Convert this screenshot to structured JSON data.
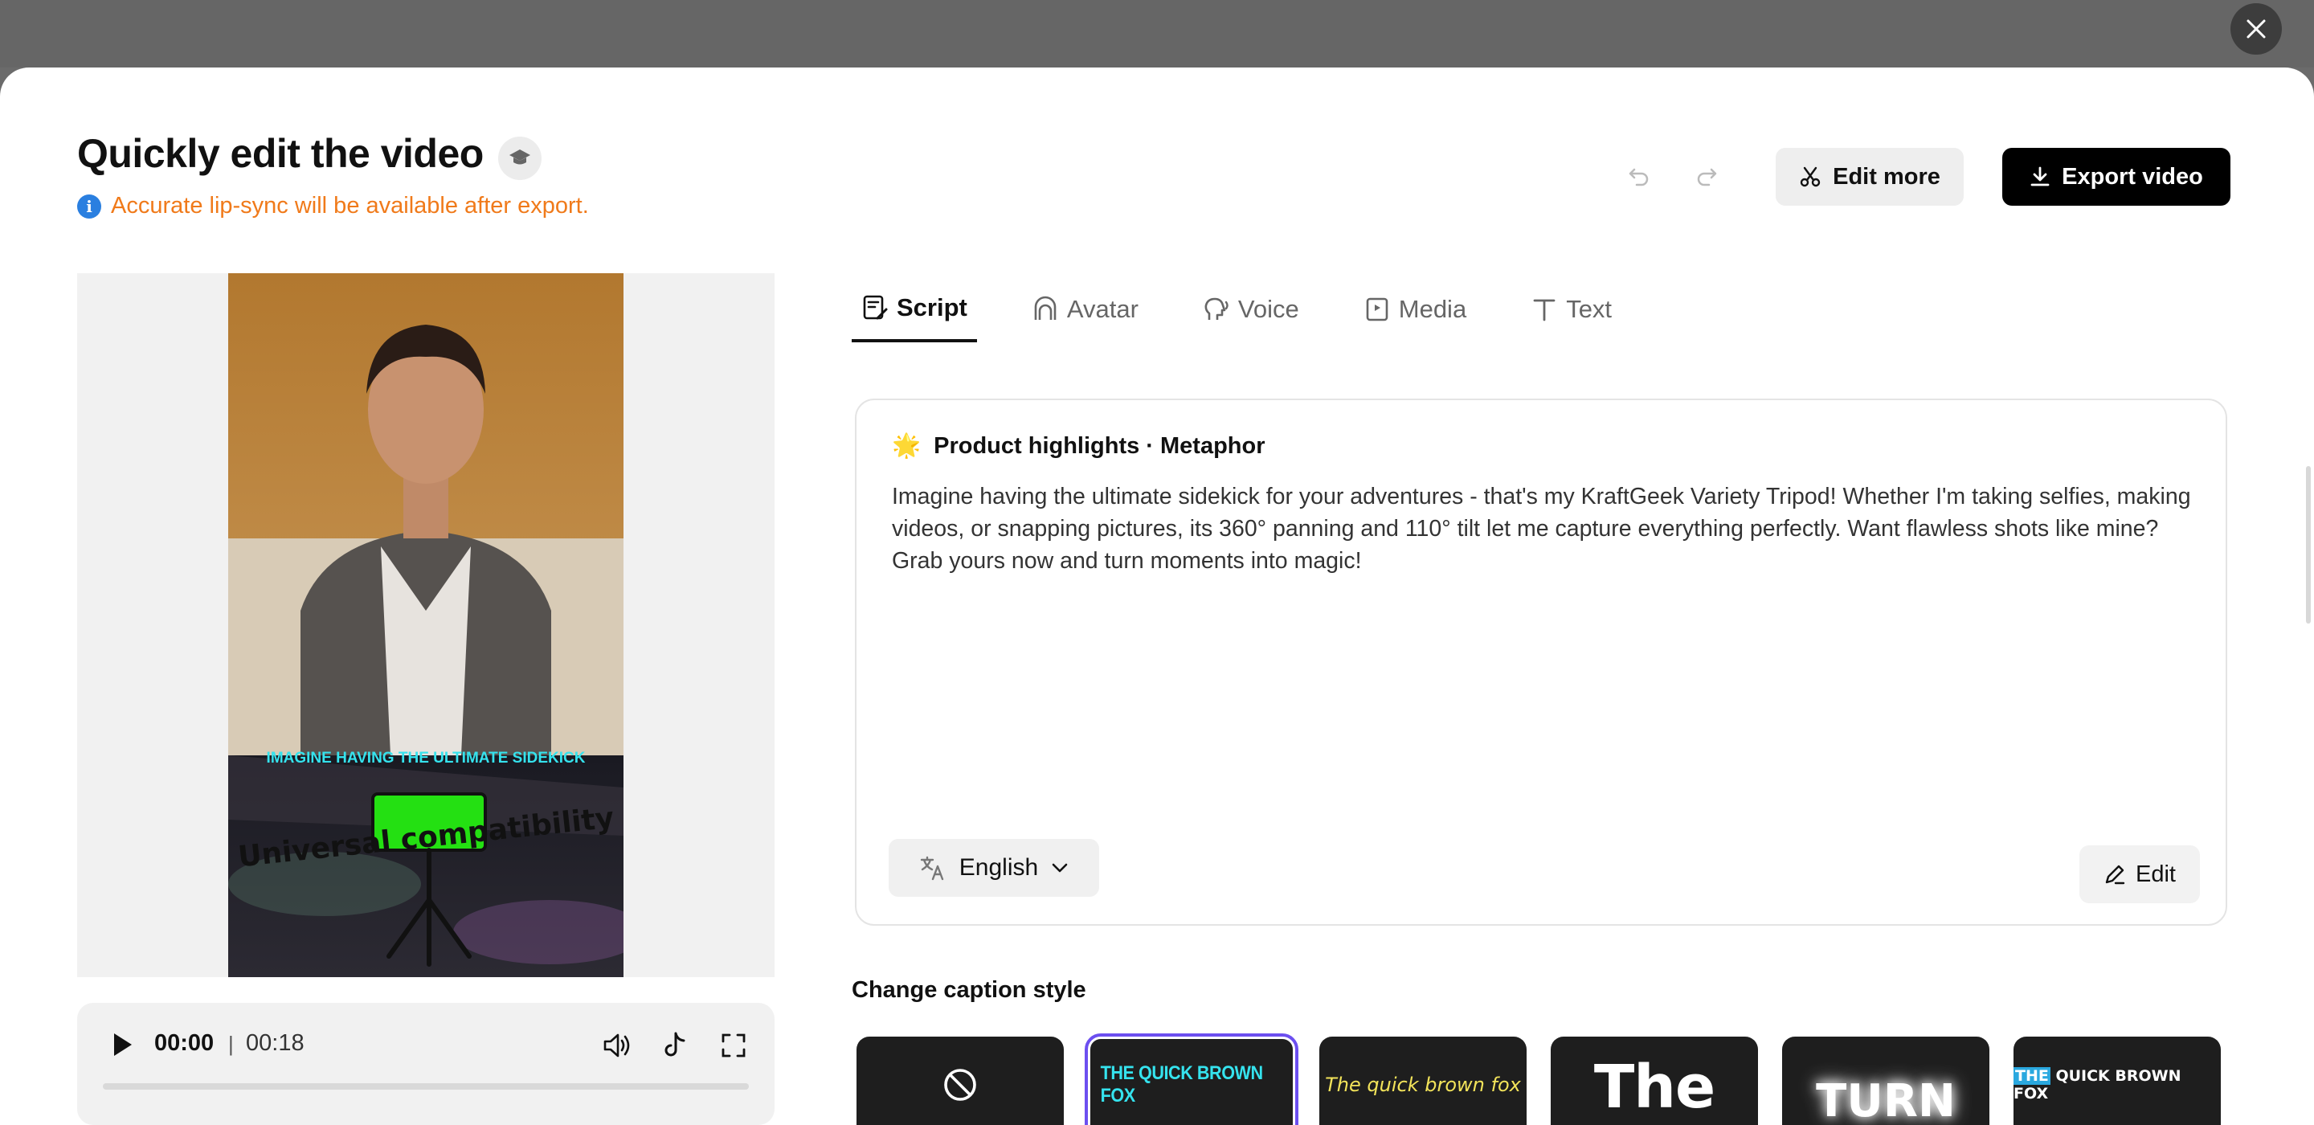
{
  "modal": {
    "title": "Quickly edit the video",
    "notice": "Accurate lip-sync will be available after export.",
    "edit_more_label": "Edit more",
    "export_label": "Export video"
  },
  "preview": {
    "caption_overlay": "IMAGINE HAVING THE ULTIMATE SIDEKICK",
    "scene_text": "Universal compatibility"
  },
  "player": {
    "current_time": "00:00",
    "separator": "|",
    "total_time": "00:18",
    "progress": 0
  },
  "tabs": [
    {
      "label": "Script",
      "icon": "script-icon",
      "active": true
    },
    {
      "label": "Avatar",
      "icon": "avatar-icon",
      "active": false
    },
    {
      "label": "Voice",
      "icon": "voice-icon",
      "active": false
    },
    {
      "label": "Media",
      "icon": "media-icon",
      "active": false
    },
    {
      "label": "Text",
      "icon": "text-icon",
      "active": false
    }
  ],
  "script": {
    "emoji": "🌟",
    "heading": "Product highlights · Metaphor",
    "body": "Imagine having the ultimate sidekick for your adventures - that's my KraftGeek Variety Tripod! Whether I'm taking selfies, making videos, or snapping pictures, its 360° panning and 110° tilt let me capture everything perfectly. Want flawless shots like mine? Grab yours now and turn moments into magic!",
    "language": "English",
    "edit_label": "Edit"
  },
  "captions": {
    "title": "Change caption style",
    "styles": [
      {
        "name": "none",
        "text": ""
      },
      {
        "name": "style-1",
        "text": "THE QUICK BROWN FOX",
        "selected": true
      },
      {
        "name": "style-2",
        "text": "The quick brown fox"
      },
      {
        "name": "style-3",
        "text": "The"
      },
      {
        "name": "style-4",
        "text": "TURN"
      },
      {
        "name": "style-5",
        "text_highlight": "THE",
        "text": " QUICK BROWN FOX"
      }
    ]
  },
  "colors": {
    "accent_selected": "#6c4ff0",
    "notice": "#f07a1a",
    "info": "#2a7fe0",
    "export_bg": "#000000"
  }
}
